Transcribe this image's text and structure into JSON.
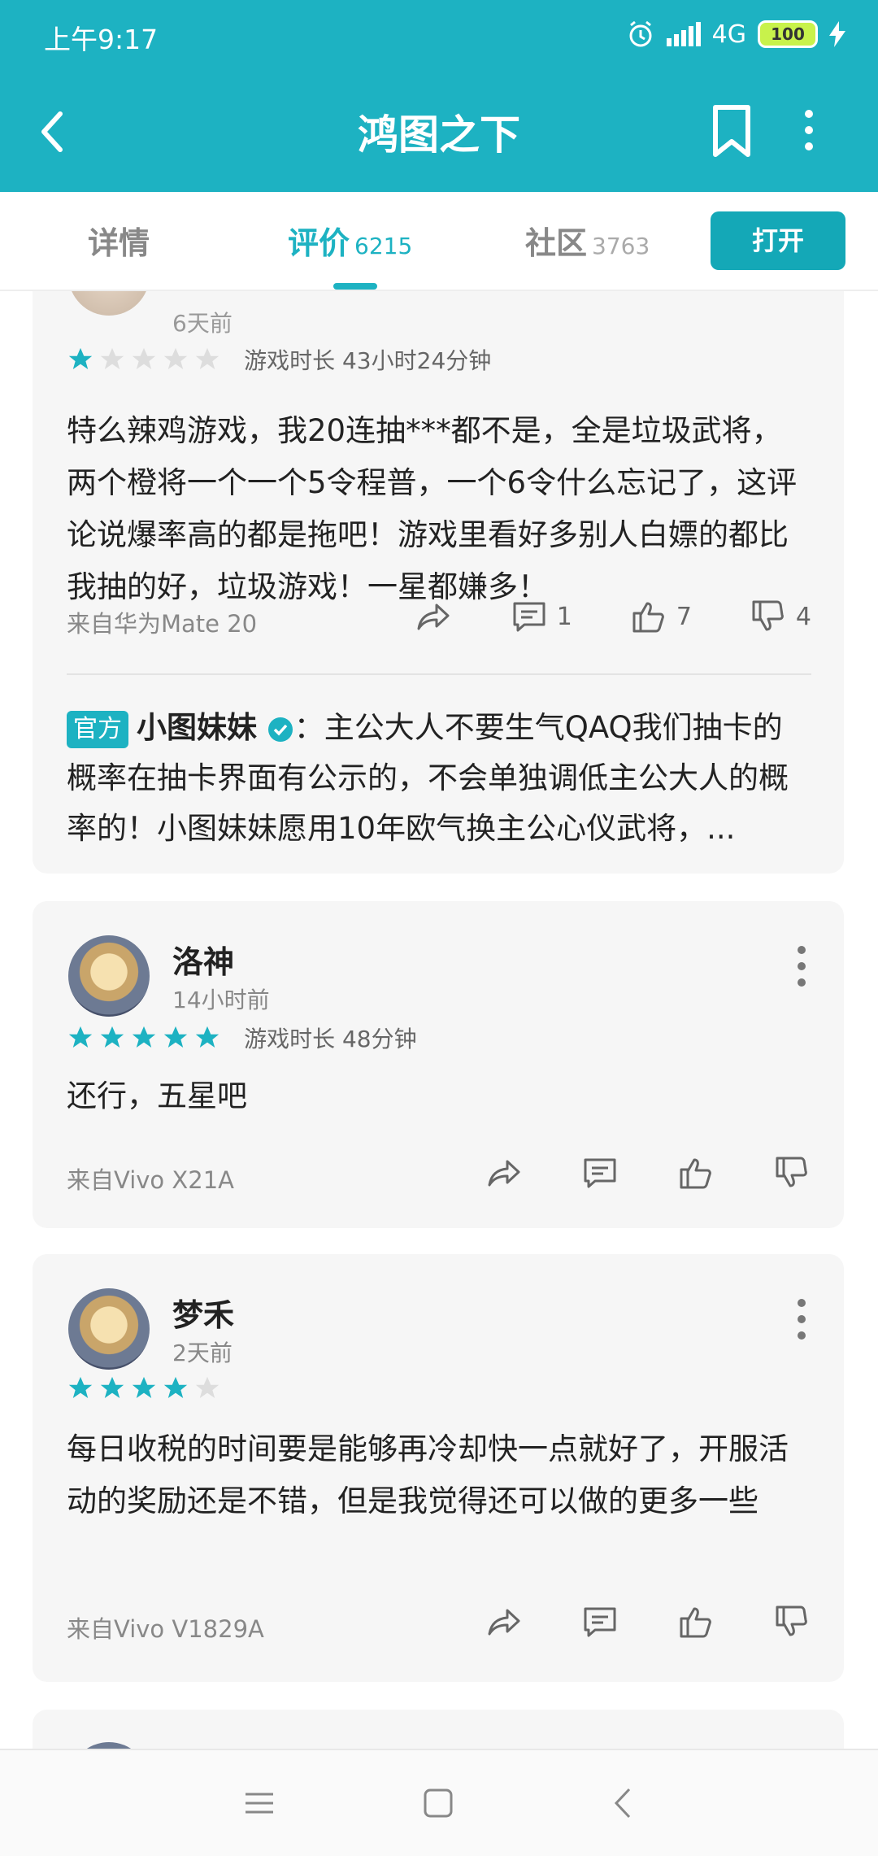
{
  "status_bar": {
    "time": "上午9:17",
    "network": "4G",
    "battery": "100"
  },
  "header": {
    "title": "鸿图之下"
  },
  "tabs": [
    {
      "label": "详情",
      "count": ""
    },
    {
      "label": "评价",
      "count": "6215"
    },
    {
      "label": "社区",
      "count": "3763"
    }
  ],
  "open_button": "打开",
  "colors": {
    "accent": "#1DB2C2",
    "star_on": "#1DB2C2",
    "star_off": "#DDDDDD"
  },
  "reviews": [
    {
      "ago": "6天前",
      "rating": 1,
      "playtime": "游戏时长 43小时24分钟",
      "text": "特么辣鸡游戏，我20连抽***都不是，全是垃圾武将，两个橙将一个一个5令程普，一个6令什么忘记了，这评论说爆率高的都是拖吧！游戏里看好多别人白嫖的都比我抽的好，垃圾游戏！一星都嫌多！",
      "device": "来自华为Mate 20",
      "comments": "1",
      "likes": "7",
      "dislikes": "4",
      "official_reply": {
        "badge": "官方",
        "name": "小图妹妹",
        "text": "：主公大人不要生气QAQ我们抽卡的概率在抽卡界面有公示的，不会单独调低主公大人的概率的！小图妹妹愿用10年欧气换主公心仪武将，..."
      }
    },
    {
      "name": "洛神",
      "ago": "14小时前",
      "rating": 5,
      "playtime": "游戏时长 48分钟",
      "text": "还行，五星吧",
      "device": "来自Vivo X21A"
    },
    {
      "name": "梦禾",
      "ago": "2天前",
      "rating": 4,
      "playtime": "",
      "text": "每日收税的时间要是能够再冷却快一点就好了，开服活动的奖励还是不错，但是我觉得还可以做的更多一些",
      "device": "来自Vivo V1829A"
    }
  ]
}
